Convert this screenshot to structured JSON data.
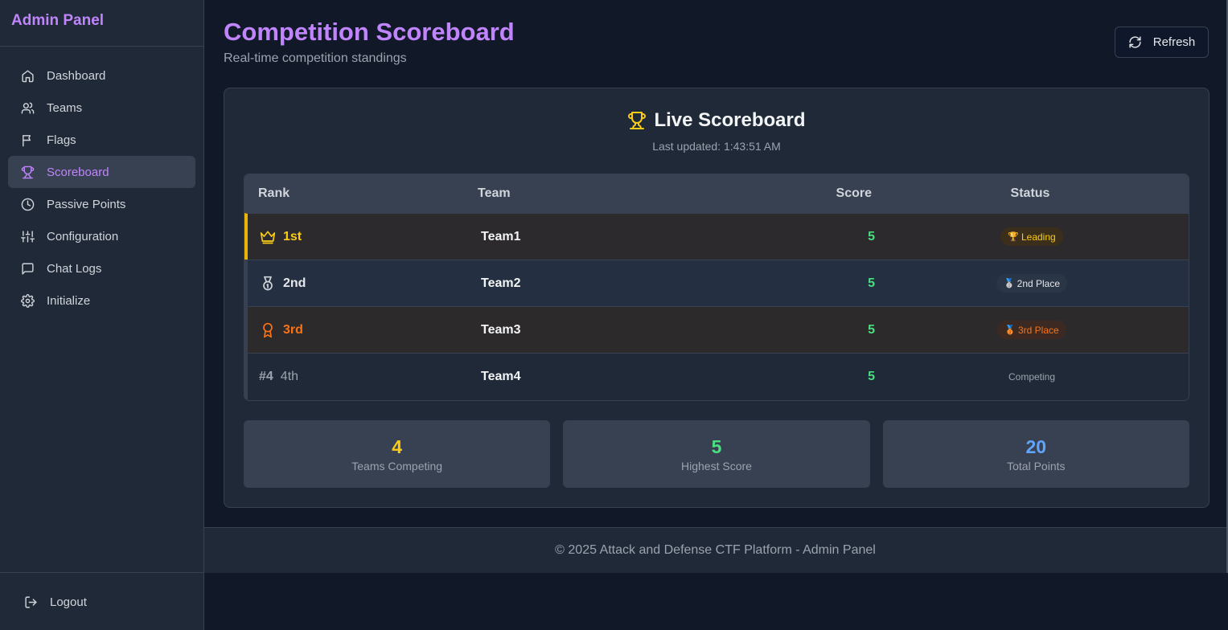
{
  "app": {
    "brand": "Admin Panel"
  },
  "sidebar": {
    "items": [
      {
        "label": "Dashboard",
        "icon": "home-icon",
        "active": false
      },
      {
        "label": "Teams",
        "icon": "users-icon",
        "active": false
      },
      {
        "label": "Flags",
        "icon": "flag-icon",
        "active": false
      },
      {
        "label": "Scoreboard",
        "icon": "trophy-icon",
        "active": true
      },
      {
        "label": "Passive Points",
        "icon": "clock-icon",
        "active": false
      },
      {
        "label": "Configuration",
        "icon": "sliders-icon",
        "active": false
      },
      {
        "label": "Chat Logs",
        "icon": "message-icon",
        "active": false
      },
      {
        "label": "Initialize",
        "icon": "gear-icon",
        "active": false
      }
    ],
    "logout_label": "Logout"
  },
  "header": {
    "title": "Competition Scoreboard",
    "subtitle": "Real-time competition standings",
    "refresh_label": "Refresh"
  },
  "scoreboard": {
    "title": "Live Scoreboard",
    "last_updated": "Last updated: 1:43:51 AM",
    "columns": {
      "rank": "Rank",
      "team": "Team",
      "score": "Score",
      "status": "Status"
    },
    "rows": [
      {
        "rank_label": "1st",
        "rank_num": "",
        "rank_icon": "crown-icon",
        "team": "Team1",
        "score": "5",
        "status": "Leading",
        "status_glyph": "🏆"
      },
      {
        "rank_label": "2nd",
        "rank_num": "",
        "rank_icon": "medal-icon",
        "team": "Team2",
        "score": "5",
        "status": "2nd Place",
        "status_glyph": "🥈"
      },
      {
        "rank_label": "3rd",
        "rank_num": "",
        "rank_icon": "award-icon",
        "team": "Team3",
        "score": "5",
        "status": "3rd Place",
        "status_glyph": "🥉"
      },
      {
        "rank_label": "4th",
        "rank_num": "#4",
        "rank_icon": "",
        "team": "Team4",
        "score": "5",
        "status": "Competing",
        "status_glyph": ""
      }
    ]
  },
  "stats": [
    {
      "value": "4",
      "label": "Teams Competing",
      "color": "#facc15"
    },
    {
      "value": "5",
      "label": "Highest Score",
      "color": "#4ade80"
    },
    {
      "value": "20",
      "label": "Total Points",
      "color": "#60a5fa"
    }
  ],
  "footer": {
    "text": "© 2025 Attack and Defense CTF Platform - Admin Panel"
  },
  "colors": {
    "accent": "#c084fc",
    "gold": "#facc15",
    "silver": "#e5e7eb",
    "bronze": "#f97316",
    "score": "#4ade80"
  }
}
